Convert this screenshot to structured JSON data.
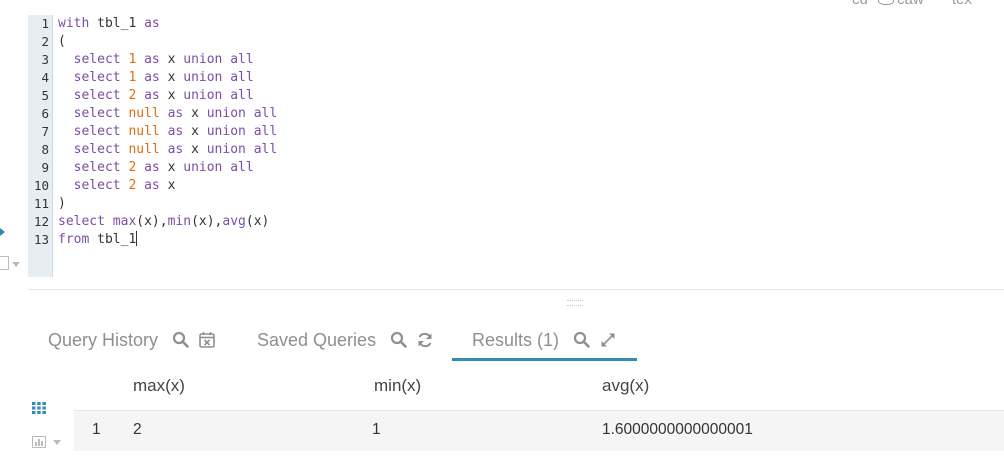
{
  "top_bar": {
    "partial_items": [
      "cd",
      "caw",
      "tex"
    ]
  },
  "editor": {
    "line_numbers": [
      "1",
      "2",
      "3",
      "4",
      "5",
      "6",
      "7",
      "8",
      "9",
      "10",
      "11",
      "12",
      "13"
    ],
    "lines": [
      [
        {
          "t": "kw",
          "v": "with"
        },
        {
          "t": "txt",
          "v": " tbl_1 "
        },
        {
          "t": "kw",
          "v": "as"
        }
      ],
      [
        {
          "t": "txt",
          "v": "("
        }
      ],
      [
        {
          "t": "txt",
          "v": "  "
        },
        {
          "t": "kw",
          "v": "select"
        },
        {
          "t": "txt",
          "v": " "
        },
        {
          "t": "num",
          "v": "1"
        },
        {
          "t": "txt",
          "v": " "
        },
        {
          "t": "kw",
          "v": "as"
        },
        {
          "t": "txt",
          "v": " x "
        },
        {
          "t": "kw",
          "v": "union all"
        }
      ],
      [
        {
          "t": "txt",
          "v": "  "
        },
        {
          "t": "kw",
          "v": "select"
        },
        {
          "t": "txt",
          "v": " "
        },
        {
          "t": "num",
          "v": "1"
        },
        {
          "t": "txt",
          "v": " "
        },
        {
          "t": "kw",
          "v": "as"
        },
        {
          "t": "txt",
          "v": " x "
        },
        {
          "t": "kw",
          "v": "union all"
        }
      ],
      [
        {
          "t": "txt",
          "v": "  "
        },
        {
          "t": "kw",
          "v": "select"
        },
        {
          "t": "txt",
          "v": " "
        },
        {
          "t": "num",
          "v": "2"
        },
        {
          "t": "txt",
          "v": " "
        },
        {
          "t": "kw",
          "v": "as"
        },
        {
          "t": "txt",
          "v": " x "
        },
        {
          "t": "kw",
          "v": "union all"
        }
      ],
      [
        {
          "t": "txt",
          "v": "  "
        },
        {
          "t": "kw",
          "v": "select"
        },
        {
          "t": "txt",
          "v": " "
        },
        {
          "t": "num",
          "v": "null"
        },
        {
          "t": "txt",
          "v": " "
        },
        {
          "t": "kw",
          "v": "as"
        },
        {
          "t": "txt",
          "v": " x "
        },
        {
          "t": "kw",
          "v": "union all"
        }
      ],
      [
        {
          "t": "txt",
          "v": "  "
        },
        {
          "t": "kw",
          "v": "select"
        },
        {
          "t": "txt",
          "v": " "
        },
        {
          "t": "num",
          "v": "null"
        },
        {
          "t": "txt",
          "v": " "
        },
        {
          "t": "kw",
          "v": "as"
        },
        {
          "t": "txt",
          "v": " x "
        },
        {
          "t": "kw",
          "v": "union all"
        }
      ],
      [
        {
          "t": "txt",
          "v": "  "
        },
        {
          "t": "kw",
          "v": "select"
        },
        {
          "t": "txt",
          "v": " "
        },
        {
          "t": "num",
          "v": "null"
        },
        {
          "t": "txt",
          "v": " "
        },
        {
          "t": "kw",
          "v": "as"
        },
        {
          "t": "txt",
          "v": " x "
        },
        {
          "t": "kw",
          "v": "union all"
        }
      ],
      [
        {
          "t": "txt",
          "v": "  "
        },
        {
          "t": "kw",
          "v": "select"
        },
        {
          "t": "txt",
          "v": " "
        },
        {
          "t": "num",
          "v": "2"
        },
        {
          "t": "txt",
          "v": " "
        },
        {
          "t": "kw",
          "v": "as"
        },
        {
          "t": "txt",
          "v": " x "
        },
        {
          "t": "kw",
          "v": "union all"
        }
      ],
      [
        {
          "t": "txt",
          "v": "  "
        },
        {
          "t": "kw",
          "v": "select"
        },
        {
          "t": "txt",
          "v": " "
        },
        {
          "t": "num",
          "v": "2"
        },
        {
          "t": "txt",
          "v": " "
        },
        {
          "t": "kw",
          "v": "as"
        },
        {
          "t": "txt",
          "v": " x"
        }
      ],
      [
        {
          "t": "txt",
          "v": ")"
        }
      ],
      [
        {
          "t": "kw",
          "v": "select"
        },
        {
          "t": "txt",
          "v": " "
        },
        {
          "t": "kw",
          "v": "max"
        },
        {
          "t": "txt",
          "v": "(x),"
        },
        {
          "t": "kw",
          "v": "min"
        },
        {
          "t": "txt",
          "v": "(x),"
        },
        {
          "t": "kw",
          "v": "avg"
        },
        {
          "t": "txt",
          "v": "(x)"
        }
      ],
      [
        {
          "t": "kw",
          "v": "from"
        },
        {
          "t": "txt",
          "v": " tbl_1"
        }
      ]
    ]
  },
  "tabs": {
    "query_history": "Query History",
    "saved_queries": "Saved Queries",
    "results": "Results (1)"
  },
  "results": {
    "columns": [
      "max(x)",
      "min(x)",
      "avg(x)"
    ],
    "rows": [
      {
        "index": "1",
        "cells": [
          "2",
          "1",
          "1.6000000000000001"
        ]
      }
    ]
  },
  "colors": {
    "keyword": "#7a4ea6",
    "number": "#e06d14",
    "accent": "#338bb8",
    "gutter": "#e6eef3"
  },
  "icons": [
    "search-icon",
    "calendar-x-icon",
    "refresh-icon",
    "expand-icon",
    "grid-icon",
    "bar-chart-icon"
  ]
}
